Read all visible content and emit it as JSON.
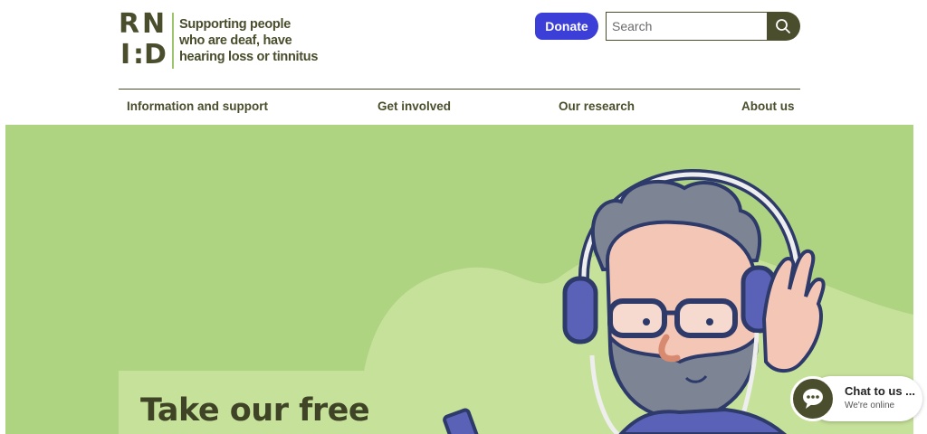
{
  "logo": {
    "letters": [
      "R",
      "N",
      "I",
      ":",
      "D"
    ],
    "tagline_lines": [
      "Supporting people",
      "who are deaf, have",
      "hearing loss or tinnitus"
    ]
  },
  "header": {
    "donate_label": "Donate",
    "search_placeholder": "Search",
    "search_icon": "search-icon"
  },
  "nav": {
    "items": [
      "Information and support",
      "Get involved",
      "Our research",
      "About us"
    ]
  },
  "hero": {
    "title": "Take our free"
  },
  "chat": {
    "title": "Chat to us ...",
    "status": "We're online",
    "icon": "chat-bubble-icon"
  },
  "colors": {
    "brand_dark": "#4a4e2c",
    "donate": "#3b3fd8",
    "hero_bg": "#aed381",
    "hero_card": "#c6e19a"
  }
}
